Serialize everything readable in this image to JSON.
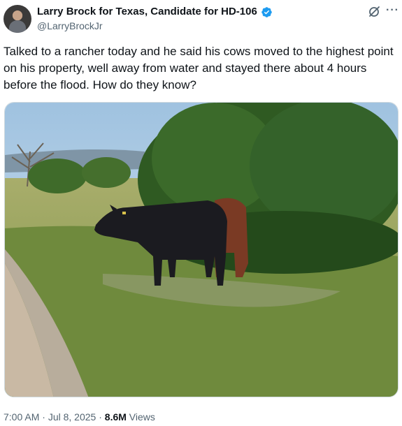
{
  "author": {
    "display_name": "Larry Brock for Texas, Candidate for HD-106",
    "handle": "@LarryBrockJr",
    "verified": true,
    "badge_color": "#1d9bf0"
  },
  "icons": {
    "grok": "grok-icon",
    "more": "more-icon",
    "more_glyph": "···",
    "verified": "verified-badge-icon"
  },
  "tweet": {
    "text": "Talked to a rancher today and he said his cows moved to the highest point on his property, well away from water and stayed there about 4 hours before the flood. How do they know?",
    "media_description": "photo-cows-under-tree"
  },
  "meta": {
    "time": "7:00 AM",
    "sep1": " · ",
    "date": "Jul 8, 2025",
    "sep2": " · ",
    "views_count": "8.6M",
    "views_label": " Views"
  },
  "colors": {
    "text": "#0f1419",
    "secondary": "#536471",
    "border": "#cfd9de"
  }
}
